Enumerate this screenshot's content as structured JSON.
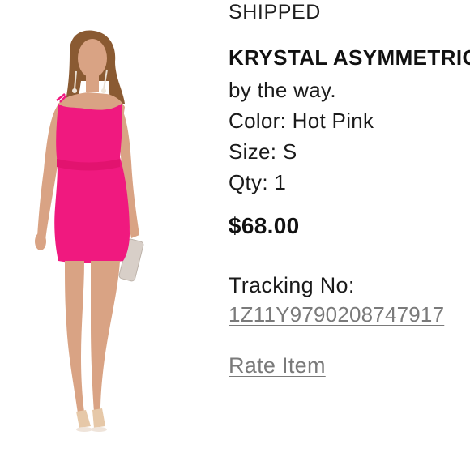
{
  "order": {
    "status": "SHIPPED",
    "product_title": "KRYSTAL ASYMMETRICAL DRESS",
    "brand": "by the way.",
    "color": "Color: Hot Pink",
    "size": "Size: S",
    "qty": "Qty: 1",
    "price": "$68.00",
    "tracking_label": "Tracking No:",
    "tracking_number": "1Z11Y9790208747917",
    "rate_item_label": "Rate Item"
  },
  "product_image": {
    "dress_color": "#f0197f",
    "skin_color": "#d9a384",
    "hair_color": "#8a5a32",
    "clutch_color": "#d8cfc8"
  }
}
